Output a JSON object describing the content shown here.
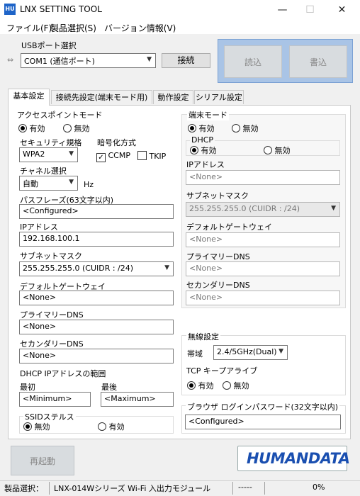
{
  "window": {
    "app_icon_text": "HU",
    "title": "LNX SETTING TOOL",
    "minimize": "—",
    "maximize": "☐",
    "close": "✕"
  },
  "menu": [
    "ファイル(F)",
    "製品選択(S)",
    "バージョン情報(V)"
  ],
  "usb": {
    "label": "USBポート選択",
    "port": "COM1 (通信ポート)",
    "connect": "接続"
  },
  "actions": {
    "read": "読込",
    "write": "書込",
    "restart": "再起動"
  },
  "tabs": [
    "基本設定",
    "接続先設定(端末モード用)",
    "動作設定",
    "シリアル設定"
  ],
  "ap": {
    "legend": "アクセスポイントモード",
    "enabled": "有効",
    "disabled": "無効",
    "enabled_selected": true,
    "security_label": "セキュリティ規格",
    "security_value": "WPA2",
    "encryption_label": "暗号化方式",
    "ccmp": "CCMP",
    "ccmp_checked": true,
    "tkip": "TKIP",
    "tkip_checked": false,
    "channel_label": "チャネル選択",
    "channel_value": "自動",
    "channel_unit": "Hz",
    "passphrase_label": "パスフレーズ(63文字以内)",
    "passphrase_value": "<Configured>",
    "ip_label": "IPアドレス",
    "ip_value": "192.168.100.1",
    "subnet_label": "サブネットマスク",
    "subnet_value": "255.255.255.0 (CUIDR : /24)",
    "gateway_label": "デフォルトゲートウェイ",
    "gateway_value": "<None>",
    "dns1_label": "プライマリーDNS",
    "dns1_value": "<None>",
    "dns2_label": "セカンダリーDNS",
    "dns2_value": "<None>",
    "dhcp_range_label": "DHCP IPアドレスの範囲",
    "first_label": "最初",
    "first_value": "<Minimum>",
    "last_label": "最後",
    "last_value": "<Maximum>",
    "stealth_legend": "SSIDステルス",
    "stealth_off": "無効",
    "stealth_on": "有効",
    "stealth_off_selected": true
  },
  "terminal": {
    "legend": "端末モード",
    "enabled": "有効",
    "disabled": "無効",
    "enabled_selected": true,
    "dhcp_legend": "DHCP",
    "dhcp_on": "有効",
    "dhcp_off": "無効",
    "dhcp_on_selected": true,
    "ip_label": "IPアドレス",
    "ip_value": "<None>",
    "subnet_label": "サブネットマスク",
    "subnet_value": "255.255.255.0 (CUIDR : /24)",
    "gateway_label": "デフォルトゲートウェイ",
    "gateway_value": "<None>",
    "dns1_label": "プライマリーDNS",
    "dns1_value": "<None>",
    "dns2_label": "セカンダリーDNS",
    "dns2_value": "<None>"
  },
  "wireless": {
    "legend": "無線設定",
    "band_label": "帯域",
    "band_value": "2.4/5GHz(Dual)",
    "keepalive_label": "TCP キープアライブ",
    "ka_on": "有効",
    "ka_off": "無効",
    "ka_on_selected": true
  },
  "browser": {
    "label": "ブラウザ ログインパスワード(32文字以内)",
    "value": "<Configured>"
  },
  "logo": {
    "text": "HUMANDATA",
    "mark": "®"
  },
  "status": {
    "product_label": "製品選択：",
    "product_value": "LNX-014Wシリーズ Wi-Fi 入出力モジュール",
    "state": "-----",
    "progress_text": "0%",
    "progress": 0
  },
  "colors": {
    "accent": "#1e64c8",
    "logo": "#1a4fb0",
    "big_button": "#d8dcdf"
  }
}
